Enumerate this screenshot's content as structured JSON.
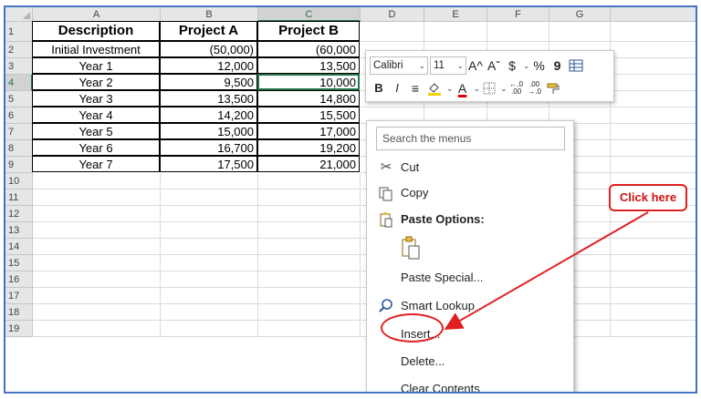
{
  "columns": [
    "A",
    "B",
    "C",
    "D",
    "E",
    "F",
    "G"
  ],
  "rows": [
    "1",
    "2",
    "3",
    "4",
    "5",
    "6",
    "7",
    "8",
    "9",
    "10",
    "11",
    "12",
    "13",
    "14",
    "15",
    "16",
    "17",
    "18",
    "19"
  ],
  "table": {
    "headers": [
      "Description",
      "Project A",
      "Project B"
    ],
    "data": [
      [
        "Initial Investment",
        "(50,000)",
        "(60,000"
      ],
      [
        "Year 1",
        "12,000",
        "13,500"
      ],
      [
        "Year 2",
        "9,500",
        "10,000"
      ],
      [
        "Year 3",
        "13,500",
        "14,800"
      ],
      [
        "Year 4",
        "14,200",
        "15,500"
      ],
      [
        "Year 5",
        "15,000",
        "17,000"
      ],
      [
        "Year 6",
        "16,700",
        "19,200"
      ],
      [
        "Year 7",
        "17,500",
        "21,000"
      ]
    ]
  },
  "mini_toolbar": {
    "font_name": "Calibri",
    "font_size": "11",
    "grow_font": "A^",
    "shrink_font": "Aˇ",
    "currency": "$",
    "percent": "%",
    "comma": "9",
    "bold": "B",
    "italic": "I",
    "align": "≡",
    "font_color": "A",
    "inc_decimal": "←.0\n.00",
    "dec_decimal": ".00\n→.0"
  },
  "context_menu": {
    "search_placeholder": "Search the menus",
    "cut": "Cut",
    "copy": "Copy",
    "paste_options": "Paste Options:",
    "paste_special": "Paste Special...",
    "smart_lookup": "Smart Lookup",
    "insert": "Insert...",
    "delete": "Delete...",
    "clear_contents": "Clear Contents"
  },
  "annotation": {
    "callout": "Click here",
    "color": "#e02020"
  },
  "colors": {
    "accent_green": "#217346",
    "frame_blue": "#4472c4"
  }
}
